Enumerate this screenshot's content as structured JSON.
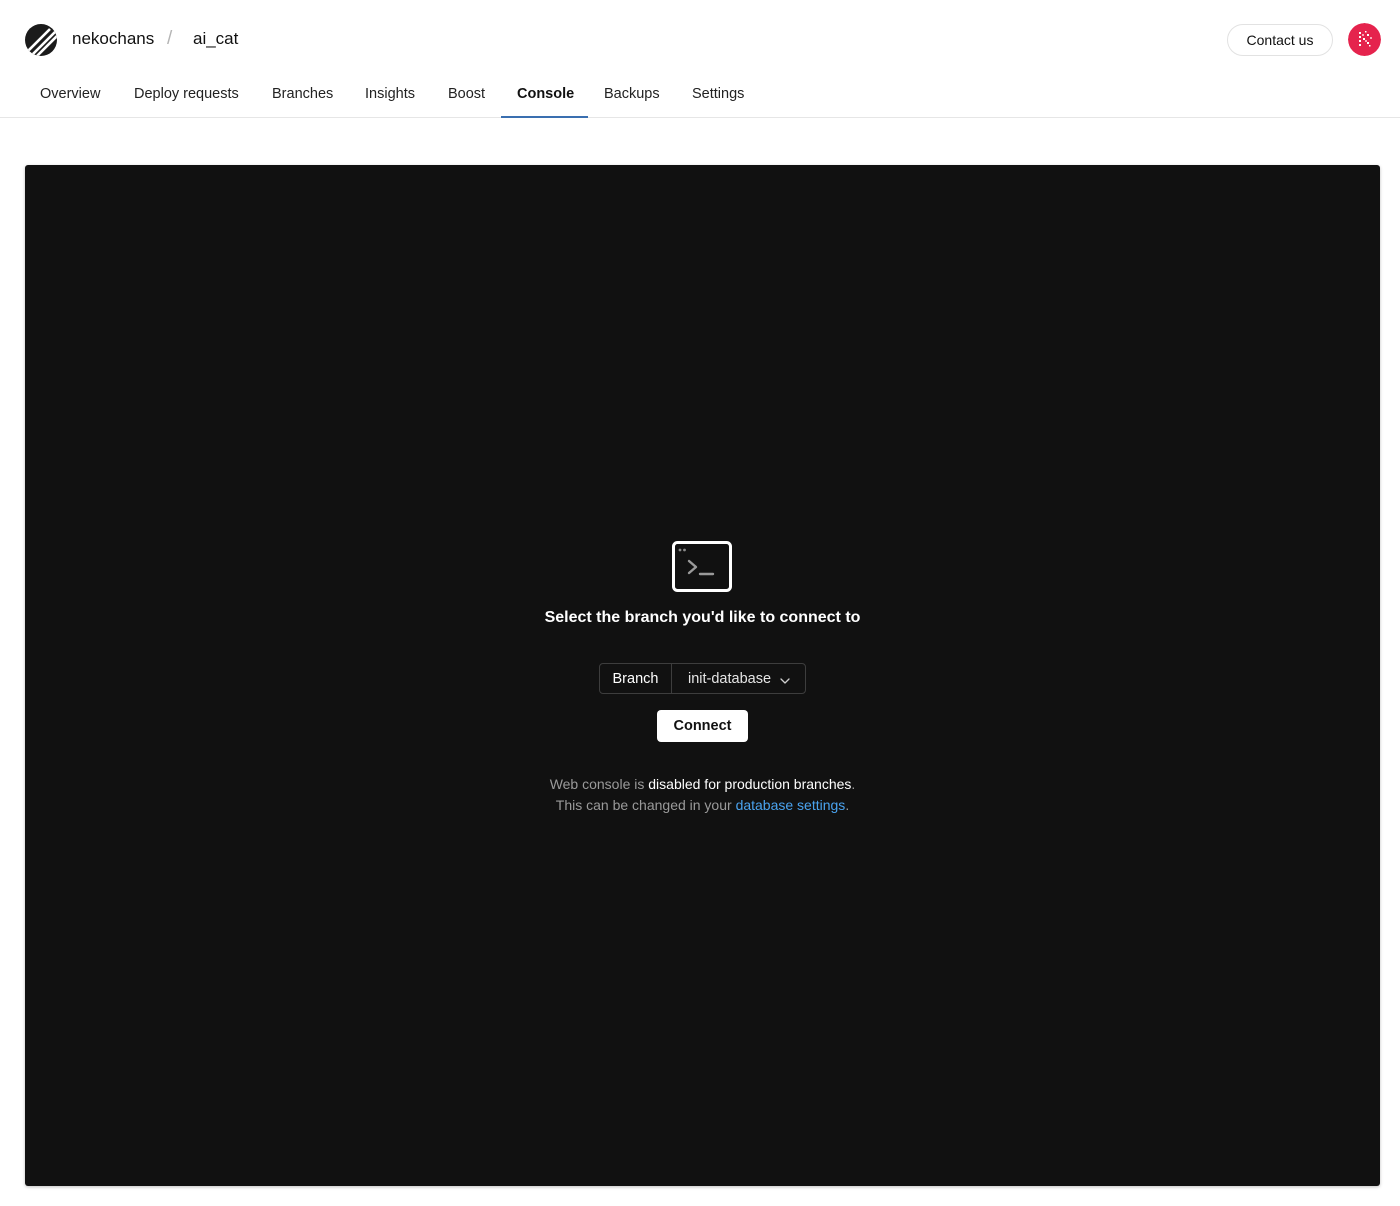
{
  "header": {
    "org": "nekochans",
    "separator": "/",
    "database": "ai_cat",
    "contact_label": "Contact us",
    "avatar_icon": "avatar-icon",
    "logo_icon": "planetscale-logo-icon"
  },
  "tabs": [
    {
      "label": "Overview"
    },
    {
      "label": "Deploy requests"
    },
    {
      "label": "Branches"
    },
    {
      "label": "Insights"
    },
    {
      "label": "Boost"
    },
    {
      "label": "Console",
      "active": true
    },
    {
      "label": "Backups"
    },
    {
      "label": "Settings"
    }
  ],
  "console": {
    "icon": "terminal-icon",
    "title": "Select the branch you'd like to connect to",
    "branch_label": "Branch",
    "branch_value": "init-database",
    "connect_label": "Connect",
    "note_line1_prefix": "Web console is ",
    "note_line1_highlight": "disabled for production branches",
    "note_line1_suffix": ".",
    "note_line2_prefix": "This can be changed in your ",
    "note_line2_link": "database settings",
    "note_line2_suffix": "."
  },
  "colors": {
    "console_bg": "#111111",
    "link": "#4aa3ef",
    "tab_underline": "#3a6fb0",
    "avatar": "#e5234d"
  }
}
